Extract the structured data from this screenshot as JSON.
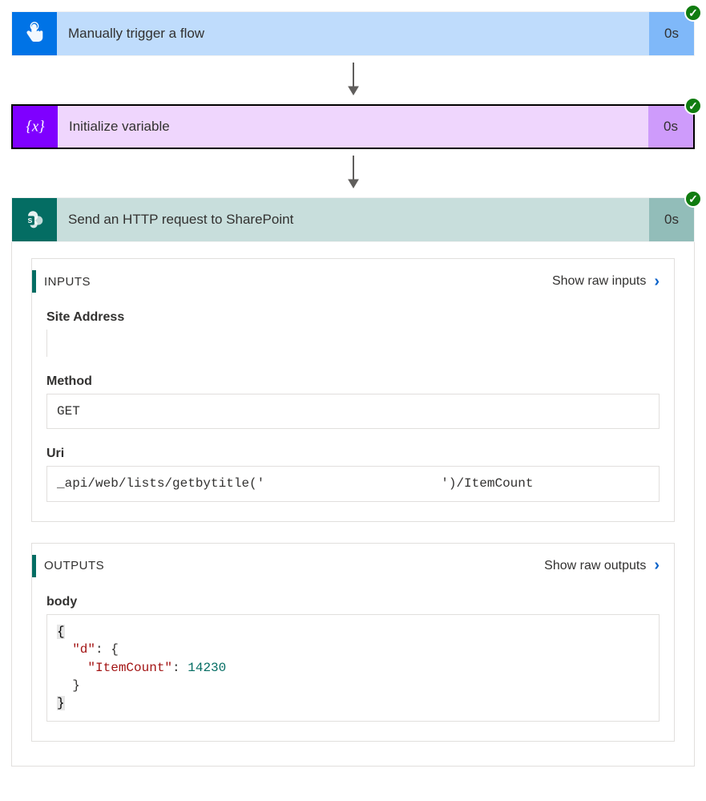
{
  "steps": [
    {
      "title": "Manually trigger a flow",
      "time": "0s"
    },
    {
      "title": "Initialize variable",
      "time": "0s"
    },
    {
      "title": "Send an HTTP request to SharePoint",
      "time": "0s"
    }
  ],
  "inputs": {
    "heading": "INPUTS",
    "rawLink": "Show raw inputs",
    "fields": {
      "siteAddressLabel": "Site Address",
      "siteAddressValue": "",
      "methodLabel": "Method",
      "methodValue": "GET",
      "uriLabel": "Uri",
      "uriValuePart1": "_api/web/lists/getbytitle('",
      "uriValuePart2": "')/ItemCount"
    }
  },
  "outputs": {
    "heading": "OUTPUTS",
    "rawLink": "Show raw outputs",
    "bodyLabel": "body",
    "body": {
      "d": {
        "ItemCount": 14230
      }
    }
  }
}
